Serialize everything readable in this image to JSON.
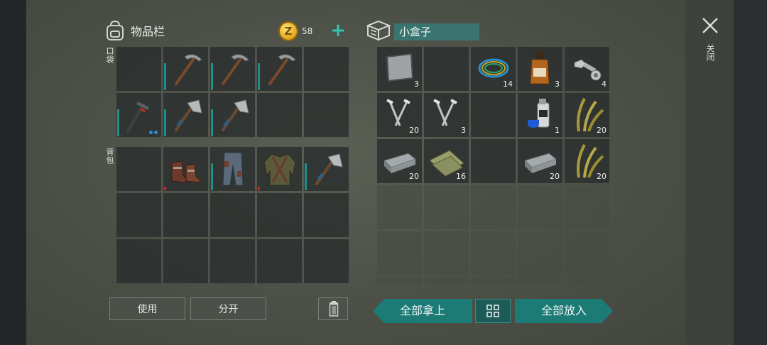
{
  "inventory": {
    "title": "物品栏",
    "money": "58",
    "section_pocket": "口袋",
    "section_backpack": "背包",
    "pocket_slots": [
      {
        "item": "",
        "icon": ""
      },
      {
        "item": "pickaxe",
        "icon": "pickaxe-icon",
        "durability": true
      },
      {
        "item": "pickaxe",
        "icon": "pickaxe-icon",
        "durability": true
      },
      {
        "item": "pickaxe",
        "icon": "pickaxe-icon",
        "durability": true
      },
      {
        "item": "",
        "icon": ""
      },
      {
        "item": "hammer",
        "icon": "hammer-icon",
        "durability": true,
        "dots": true
      },
      {
        "item": "hatchet",
        "icon": "hatchet-icon",
        "durability": true
      },
      {
        "item": "hatchet",
        "icon": "hatchet-icon",
        "durability": true
      },
      {
        "item": "",
        "icon": ""
      },
      {
        "item": "",
        "icon": ""
      }
    ],
    "backpack_slots": [
      {
        "item": "",
        "icon": ""
      },
      {
        "item": "boots",
        "icon": "boots-icon",
        "red": true
      },
      {
        "item": "pants",
        "icon": "pants-icon",
        "durability": true
      },
      {
        "item": "jacket",
        "icon": "jacket-icon",
        "red": true
      },
      {
        "item": "hatchet",
        "icon": "hatchet-icon",
        "durability": true
      },
      {
        "item": "",
        "icon": ""
      },
      {
        "item": "",
        "icon": ""
      },
      {
        "item": "",
        "icon": ""
      },
      {
        "item": "",
        "icon": ""
      },
      {
        "item": "",
        "icon": ""
      },
      {
        "item": "",
        "icon": ""
      },
      {
        "item": "",
        "icon": ""
      },
      {
        "item": "",
        "icon": ""
      },
      {
        "item": "",
        "icon": ""
      },
      {
        "item": "",
        "icon": ""
      }
    ],
    "use_label": "使用",
    "split_label": "分开"
  },
  "container": {
    "title": "小盒子",
    "slots": [
      {
        "icon": "iron-plate-icon",
        "count": "3"
      },
      {
        "icon": "",
        "count": ""
      },
      {
        "icon": "wire-icon",
        "count": "14"
      },
      {
        "icon": "whiskey-bottle-icon",
        "count": "3"
      },
      {
        "icon": "bolt-nut-icon",
        "count": "4"
      },
      {
        "icon": "nails-icon",
        "count": "20"
      },
      {
        "icon": "nails-icon",
        "count": "3"
      },
      {
        "icon": "",
        "count": ""
      },
      {
        "icon": "spray-can-icon",
        "count": "1"
      },
      {
        "icon": "plant-fiber-icon",
        "count": "20"
      },
      {
        "icon": "iron-ingot-icon",
        "count": "20"
      },
      {
        "icon": "cloth-icon",
        "count": "16"
      },
      {
        "icon": "",
        "count": ""
      },
      {
        "icon": "iron-ingot-icon",
        "count": "20"
      },
      {
        "icon": "plant-fiber-icon",
        "count": "20"
      }
    ],
    "empty_rows": 3,
    "take_all_label": "全部拿上",
    "put_all_label": "全部放入"
  },
  "close_label": "关闭",
  "colors": {
    "accent": "#1d7b76",
    "durability": "#1e8f8a",
    "coin": "#e2a91c"
  }
}
